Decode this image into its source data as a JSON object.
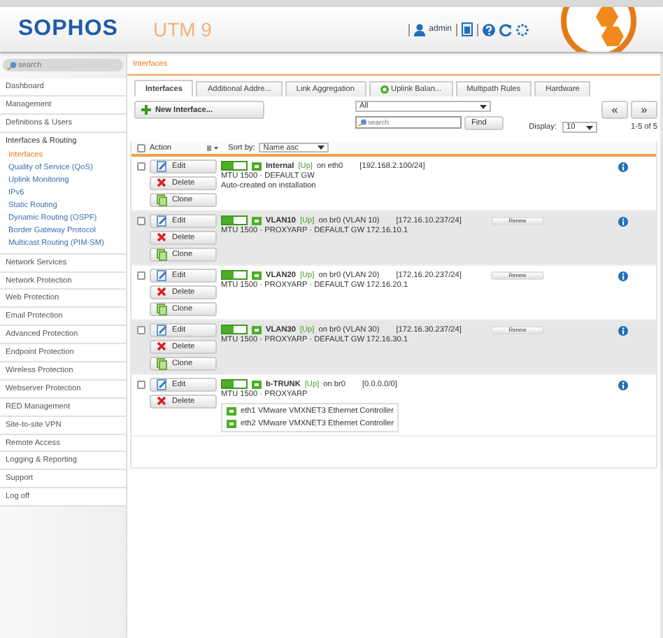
{
  "header": {
    "logo": "SOPHOS",
    "product": "UTM 9",
    "user": "admin"
  },
  "sidebar": {
    "search": {
      "placeholder": "search"
    },
    "items": [
      {
        "label": "Dashboard",
        "selected": false
      },
      {
        "label": "Management",
        "selected": false
      },
      {
        "label": "Definitions & Users",
        "selected": false
      },
      {
        "label": "Interfaces & Routing",
        "selected": false,
        "children": [
          {
            "label": "Interfaces",
            "selected": true
          },
          {
            "label": "Quality of Service (QoS)",
            "selected": false
          },
          {
            "label": "Uplink Monitoring",
            "selected": false
          },
          {
            "label": "IPv6",
            "selected": false
          },
          {
            "label": "Static Routing",
            "selected": false
          },
          {
            "label": "Dynamic Routing (OSPF)",
            "selected": false
          },
          {
            "label": "Border Gateway Protocol",
            "selected": false
          },
          {
            "label": "Multicast Routing (PIM-SM)",
            "selected": false
          }
        ]
      },
      {
        "label": "Network Services",
        "selected": false
      },
      {
        "label": "Network Protection",
        "selected": false
      },
      {
        "label": "Web Protection",
        "selected": false
      },
      {
        "label": "Email Protection",
        "selected": false
      },
      {
        "label": "Advanced Protection",
        "selected": false
      },
      {
        "label": "Endpoint Protection",
        "selected": false
      },
      {
        "label": "Wireless Protection",
        "selected": false
      },
      {
        "label": "Webserver Protection",
        "selected": false
      },
      {
        "label": "RED Management",
        "selected": false
      },
      {
        "label": "Site-to-site VPN",
        "selected": false
      },
      {
        "label": "Remote Access",
        "selected": false
      },
      {
        "label": "Logging & Reporting",
        "selected": false
      },
      {
        "label": "Support",
        "selected": false
      },
      {
        "label": "Log off",
        "selected": false
      }
    ]
  },
  "breadcrumb": "Interfaces",
  "tabs": [
    {
      "label": "Interfaces",
      "selected": true,
      "kind": "plain"
    },
    {
      "label": "Additional Addre...",
      "selected": false,
      "kind": "plain"
    },
    {
      "label": "Link Aggregation",
      "selected": false,
      "kind": "plain"
    },
    {
      "label": "Uplink Balan...",
      "selected": false,
      "kind": "status"
    },
    {
      "label": "Multipath Rules",
      "selected": false,
      "kind": "plain"
    },
    {
      "label": "Hardware",
      "selected": false,
      "kind": "plain"
    }
  ],
  "toolbar": {
    "new_button": "New Interface...",
    "filter": "All",
    "search": {
      "placeholder": "search"
    },
    "find": "Find",
    "display_label": "Display:",
    "display_value": "10",
    "prev": "«",
    "next": "»",
    "count": "1-5 of 5"
  },
  "table": {
    "action_header": "Action",
    "sort_label": "Sort by:",
    "sort_value": "Name asc",
    "checked": false,
    "rows": [
      {
        "checked": false,
        "enabled": true,
        "actions": [
          "Edit",
          "Delete",
          "Clone"
        ],
        "name": "Internal",
        "status": "[Up]",
        "on": "on eth0",
        "address": "[192.168.2.100/24]",
        "details": "MTU 1500 · DEFAULT GW",
        "note": "Auto-created on installation"
      },
      {
        "checked": false,
        "enabled": true,
        "actions": [
          "Edit",
          "Delete",
          "Clone"
        ],
        "name": "VLAN10",
        "status": "[Up]",
        "on": "on br0 (VLAN 10)",
        "address": "[172.16.10.237/24]",
        "renew": "Renew",
        "details": "MTU 1500 · PROXYARP · DEFAULT GW 172.16.10.1"
      },
      {
        "checked": false,
        "enabled": true,
        "actions": [
          "Edit",
          "Delete",
          "Clone"
        ],
        "name": "VLAN20",
        "status": "[Up]",
        "on": "on br0 (VLAN 20)",
        "address": "[172.16.20.237/24]",
        "renew": "Renew",
        "details": "MTU 1500 · PROXYARP · DEFAULT GW 172.16.20.1"
      },
      {
        "checked": false,
        "enabled": true,
        "actions": [
          "Edit",
          "Delete",
          "Clone"
        ],
        "name": "VLAN30",
        "status": "[Up]",
        "on": "on br0 (VLAN 30)",
        "address": "[172.16.30.237/24]",
        "renew": "Renew",
        "details": "MTU 1500 · PROXYARP · DEFAULT GW 172.16.30.1"
      },
      {
        "checked": false,
        "enabled": true,
        "actions": [
          "Edit",
          "Delete"
        ],
        "name": "b-TRUNK",
        "status": "[Up]",
        "on": "on br0",
        "address": "[0.0.0.0/0]",
        "details": "MTU 1500 · PROXYARP",
        "ports": [
          "eth1 VMware VMXNET3 Ethernet Controller",
          "eth2 VMware VMXNET3 Ethernet Controller"
        ]
      }
    ]
  }
}
